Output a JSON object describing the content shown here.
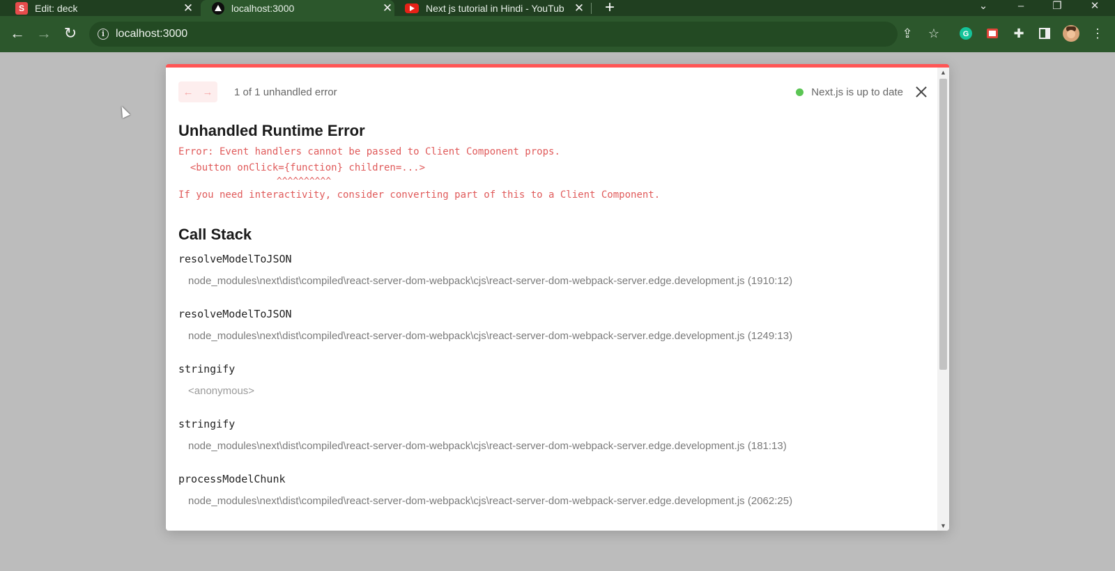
{
  "browser": {
    "tabs": [
      {
        "title": "Edit: deck",
        "icon": "s-logo-icon"
      },
      {
        "title": "localhost:3000",
        "icon": "vercel-logo-icon",
        "active": true
      },
      {
        "title": "Next js tutorial in Hindi - YouTub",
        "icon": "youtube-logo-icon"
      }
    ],
    "new_tab": "+",
    "address": "localhost:3000"
  },
  "dialog": {
    "pager_label": "1 of 1 unhandled error",
    "status": "Next.js is up to date",
    "error_title": "Unhandled Runtime Error",
    "error_message_lines": [
      "Error: Event handlers cannot be passed to Client Component props.",
      "  <button onClick={function} children=...>",
      "                  ^^^^^^^^^^",
      "If you need interactivity, consider converting part of this to a Client Component."
    ],
    "call_stack_title": "Call Stack",
    "frames": [
      {
        "function": "resolveModelToJSON",
        "location": "node_modules\\next\\dist\\compiled\\react-server-dom-webpack\\cjs\\react-server-dom-webpack-server.edge.development.js (1910:12)"
      },
      {
        "function": "resolveModelToJSON",
        "location": "node_modules\\next\\dist\\compiled\\react-server-dom-webpack\\cjs\\react-server-dom-webpack-server.edge.development.js (1249:13)"
      },
      {
        "function": "stringify",
        "location": "<anonymous>"
      },
      {
        "function": "stringify",
        "location": "node_modules\\next\\dist\\compiled\\react-server-dom-webpack\\cjs\\react-server-dom-webpack-server.edge.development.js (181:13)"
      },
      {
        "function": "processModelChunk",
        "location": "node_modules\\next\\dist\\compiled\\react-server-dom-webpack\\cjs\\react-server-dom-webpack-server.edge.development.js (2062:25)"
      }
    ]
  },
  "colors": {
    "tab_strip": "#203f20",
    "toolbar": "#2c572c",
    "error_red": "#e05a5a",
    "dialog_accent": "#ff5555",
    "status_dot": "#5bc554"
  }
}
